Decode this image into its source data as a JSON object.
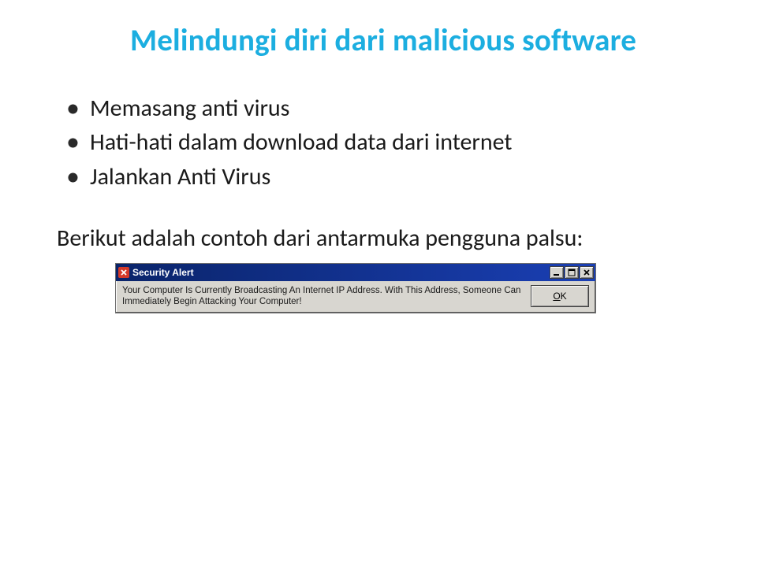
{
  "title": "Melindungi diri dari malicious software",
  "bullets": [
    "Memasang anti virus",
    "Hati-hati dalam download data dari internet",
    "Jalankan Anti Virus"
  ],
  "paragraph": "Berikut adalah contoh dari antarmuka pengguna palsu:",
  "dialog": {
    "title": "Security Alert",
    "message": "Your Computer Is Currently Broadcasting An Internet IP Address. With This Address, Someone Can Immediately Begin Attacking Your Computer!",
    "ok_label": "OK"
  }
}
